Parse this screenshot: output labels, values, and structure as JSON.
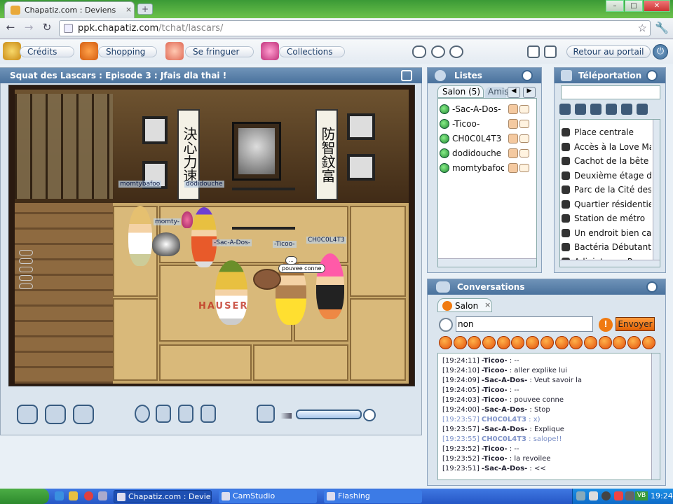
{
  "browser": {
    "tab_title": "Chapatiz.com : Deviens le ...",
    "tab_close": "×",
    "new_tab": "+",
    "url_domain": "ppk.chapatiz.com",
    "url_path": "/tchat/lascars/",
    "win_min": "–",
    "win_max": "□",
    "win_close": "✕"
  },
  "menu": {
    "credits": "Crédits",
    "shopping": "Shopping",
    "fringuer": "Se fringuer",
    "collections": "Collections",
    "portal": "Retour au portail"
  },
  "room": {
    "title": "Squat des Lascars : Episode 3 : Jfais dla thai !",
    "kanji_left": "決心力速",
    "kanji_right": "防智鈫富",
    "names": {
      "momty": "momtybafoo",
      "sac": "-Sac-A-Dos-",
      "ticoo": "-Ticoo-",
      "chocolat": "CH0C0L4T3",
      "momty_short": "momty-",
      "tag_left": "momtybafoo",
      "tag_top": "dodidouche"
    },
    "bubble": "pouvee conne",
    "bubble_small": "...",
    "floor_text": "HAUSER"
  },
  "listes": {
    "title": "Listes",
    "tab_salon": "Salon (5)",
    "tab_amis": "Amis",
    "users": [
      "-Sac-A-Dos-",
      "-Ticoo-",
      "CH0C0L4T3",
      "dodidouche",
      "momtybafoo"
    ]
  },
  "teleport": {
    "title": "Téléportation",
    "places": [
      "Place centrale",
      "Accès à la Love Mac",
      "Cachot de la bête",
      "Deuxième étage du",
      "Parc de la Cité des",
      "Quartier résidentiel",
      "Station de métro",
      "Un endroit bien calr",
      "Bactéria Débutant",
      "Adjoint ... o. P..."
    ]
  },
  "conversations": {
    "title": "Conversations",
    "tab": "Salon",
    "tab_close": "×",
    "input_value": "non",
    "send": "Envoyer",
    "messages": [
      {
        "time": "[19:24:11]",
        "name": "-Ticoo-",
        "text": " : --",
        "dim": false
      },
      {
        "time": "[19:24:10]",
        "name": "-Ticoo-",
        "text": " : aller explike lui",
        "dim": false
      },
      {
        "time": "[19:24:09]",
        "name": "-Sac-A-Dos-",
        "text": " : Veut savoir la",
        "dim": false
      },
      {
        "time": "[19:24:05]",
        "name": "-Ticoo-",
        "text": " : --",
        "dim": false
      },
      {
        "time": "[19:24:03]",
        "name": "-Ticoo-",
        "text": " : pouvee conne",
        "dim": false
      },
      {
        "time": "[19:24:00]",
        "name": "-Sac-A-Dos-",
        "text": " : Stop",
        "dim": false
      },
      {
        "time": "[19:23:57]",
        "name": "CH0C0L4T3",
        "text": " : x)",
        "dim": true
      },
      {
        "time": "[19:23:57]",
        "name": "-Sac-A-Dos-",
        "text": " : Explique",
        "dim": false
      },
      {
        "time": "[19:23:55]",
        "name": "CH0C0L4T3",
        "text": " : salope!!",
        "dim": true
      },
      {
        "time": "[19:23:52]",
        "name": "-Ticoo-",
        "text": " : --",
        "dim": false
      },
      {
        "time": "[19:23:52]",
        "name": "-Ticoo-",
        "text": " : la revoilee",
        "dim": false
      },
      {
        "time": "[19:23:51]",
        "name": "-Sac-A-Dos-",
        "text": " : <<",
        "dim": false
      }
    ]
  },
  "taskbar": {
    "item1": "Chapatiz.com : Devien...",
    "item2": "CamStudio",
    "item3": "Flashing",
    "clock": "19:24",
    "tray_vb": "VB"
  },
  "colors": {
    "accent": "#4a729d",
    "send_button": "#f07a10",
    "chrome_frame": "#3b9a36"
  }
}
